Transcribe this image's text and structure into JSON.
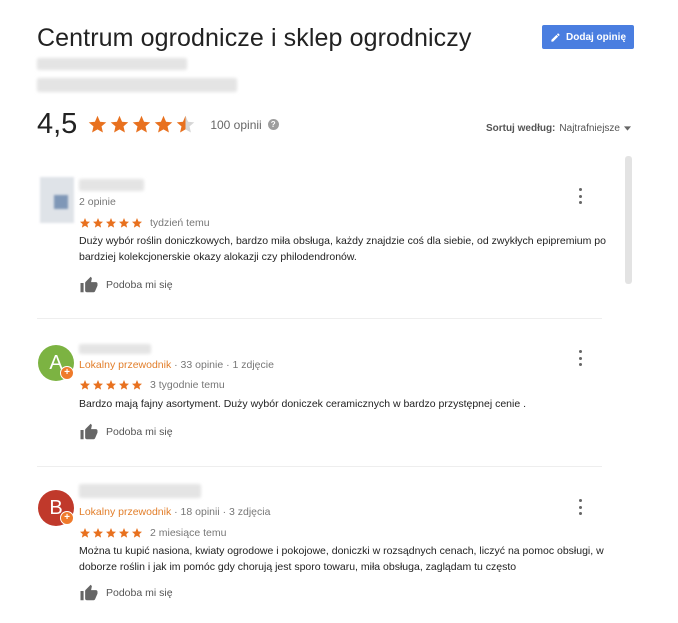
{
  "header": {
    "title": "Centrum ogrodnicze i sklep ogrodniczy",
    "add_review_label": "Dodaj opinię"
  },
  "summary": {
    "rating": "4,5",
    "rating_value": 4.5,
    "review_count": "100 opinii",
    "sort_label": "Sortuj według:",
    "sort_value": "Najtrafniejsze"
  },
  "colors": {
    "star": "#e8711f",
    "button": "#4a7ee0",
    "local_guide": "#e27e2a",
    "avatar_a": "#7cb342",
    "avatar_b": "#c0392b"
  },
  "reviews": [
    {
      "avatar_letter": "",
      "meta_guide": "",
      "meta_rest": "2 opinie",
      "stars": 5,
      "time": "tydzień temu",
      "text": "Duży wybór roślin doniczkowych, bardzo miła obsługa, każdy znajdzie coś dla siebie, od zwykłych epipremium po bardziej kolekcjonerskie okazy alokazji czy philodendronów.",
      "like_label": "Podoba mi się"
    },
    {
      "avatar_letter": "A",
      "meta_guide": "Lokalny przewodnik",
      "meta_rest": " · 33 opinie · 1 zdjęcie",
      "stars": 5,
      "time": "3 tygodnie temu",
      "text": "Bardzo mają fajny asortyment. Duży wybór doniczek ceramicznych w bardzo przystępnej cenie  .",
      "like_label": "Podoba mi się"
    },
    {
      "avatar_letter": "B",
      "meta_guide": "Lokalny przewodnik",
      "meta_rest": " · 18 opinii · 3 zdjęcia",
      "stars": 5,
      "time": "2 miesiące temu",
      "text": "Można tu kupić nasiona, kwiaty ogrodowe i pokojowe, doniczki w rozsądnych cenach, liczyć na pomoc obsługi, w doborze roślin i jak im pomóc gdy chorują jest sporo towaru, miła obsługa, zaglądam tu często",
      "like_label": "Podoba mi się"
    }
  ]
}
